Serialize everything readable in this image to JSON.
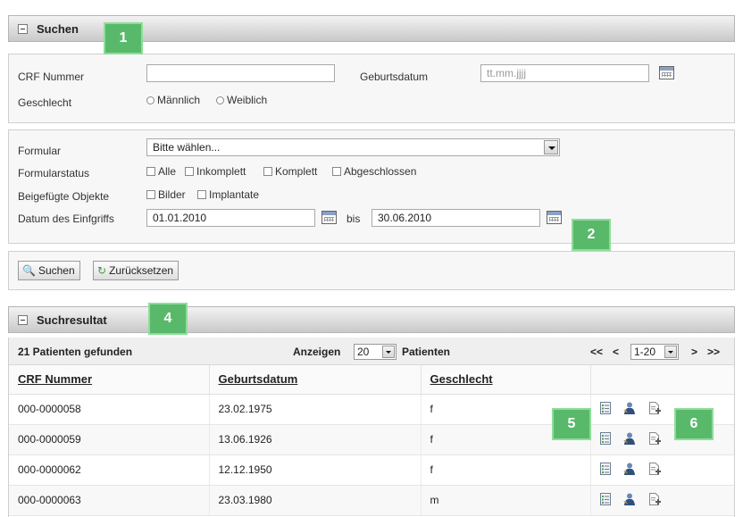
{
  "search_panel": {
    "title": "Suchen",
    "crf_label": "CRF Nummer",
    "crf_value": "",
    "birth_label": "Geburtsdatum",
    "birth_placeholder": "tt.mm.jjjj",
    "gender_label": "Geschlecht",
    "gender_male": "Männlich",
    "gender_female": "Weiblich",
    "form_label": "Formular",
    "form_value": "Bitte wählen...",
    "status_label": "Formularstatus",
    "status_options": [
      "Alle",
      "Inkomplett",
      "Komplett",
      "Abgeschlossen"
    ],
    "objects_label": "Beigefügte Objekte",
    "objects_options": [
      "Bilder",
      "Implantate"
    ],
    "date_label": "Datum des Einfgriffs",
    "date_from": "01.01.2010",
    "date_to_label": "bis",
    "date_to": "30.06.2010",
    "search_button": "Suchen",
    "reset_button": "Zurücksetzen"
  },
  "results_panel": {
    "title": "Suchresultat",
    "found_text": "21 Patienten gefunden",
    "show_label": "Anzeigen",
    "page_size": "20",
    "patients_label": "Patienten",
    "pager": {
      "first": "<<",
      "prev": "<",
      "range": "1-20",
      "next": ">",
      "last": ">>"
    },
    "columns": [
      "CRF Nummer",
      "Geburtsdatum",
      "Geschlecht",
      ""
    ],
    "rows": [
      {
        "crf": "000-0000058",
        "birth": "23.02.1975",
        "gender": "f"
      },
      {
        "crf": "000-0000059",
        "birth": "13.06.1926",
        "gender": "f"
      },
      {
        "crf": "000-0000062",
        "birth": "12.12.1950",
        "gender": "f"
      },
      {
        "crf": "000-0000063",
        "birth": "23.03.1980",
        "gender": "m"
      }
    ],
    "row_icons": [
      "list-icon",
      "patient-icon",
      "add-document-icon"
    ]
  },
  "badges": [
    "1",
    "2",
    "4",
    "5",
    "6"
  ],
  "colors": {
    "badge": "#59b96a",
    "header_gradient_top": "#f3f3f3",
    "header_gradient_bottom": "#c9c9c9"
  }
}
